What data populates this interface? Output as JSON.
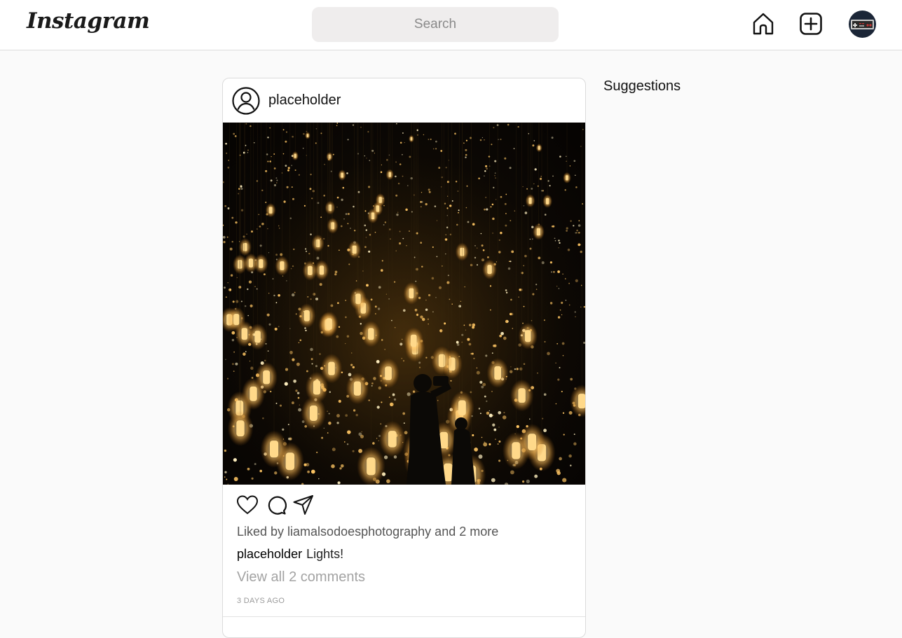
{
  "header": {
    "logo_text": "Instagram",
    "search_placeholder": "Search",
    "icons": [
      "home-icon",
      "create-post-icon",
      "profile-avatar"
    ]
  },
  "post": {
    "username": "placeholder",
    "image_alt": "Lights",
    "actions": [
      "like-icon",
      "comment-icon",
      "share-icon"
    ],
    "likes_text": "Liked by liamalsodoesphotography and 2 more",
    "caption_user": "placeholder",
    "caption_text": "Lights!",
    "view_comments": "View all 2 comments",
    "timestamp": "3 DAYS AGO"
  },
  "sidebar": {
    "title": "Suggestions"
  },
  "colors": {
    "background": "#fafafa",
    "header_bg": "#ffffff",
    "search_bg": "#efeded",
    "muted_text": "#a3a3a3",
    "lantern_glow": "#ffbf5a"
  }
}
